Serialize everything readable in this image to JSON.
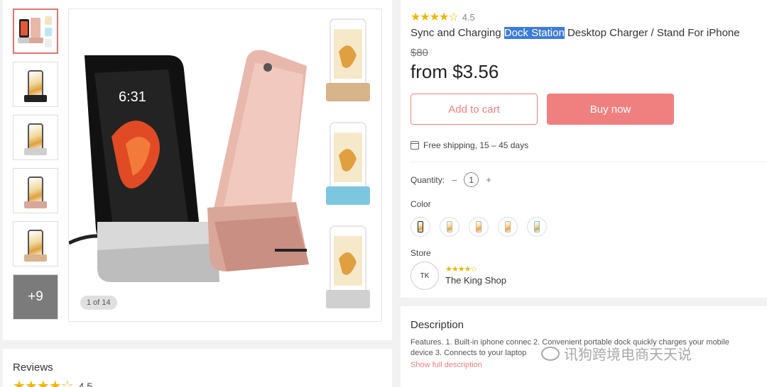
{
  "gallery": {
    "counter": "1 of 14",
    "more_label": "+9",
    "thumbnails": [
      {
        "alt": "dock-pair",
        "base": "#e8b7a8"
      },
      {
        "alt": "dock-black",
        "base": "#222222"
      },
      {
        "alt": "dock-silver",
        "base": "#cfcfcf"
      },
      {
        "alt": "dock-rose",
        "base": "#d9a79a"
      },
      {
        "alt": "dock-gold",
        "base": "#d8b48a"
      }
    ]
  },
  "product": {
    "rating_value": "4.5",
    "title_before": "Sync and Charging ",
    "title_highlight": "Dock Station",
    "title_after": " Desktop Charger / Stand For iPhone",
    "old_price": "$80",
    "price": "from $3.56",
    "add_to_cart": "Add to cart",
    "buy_now": "Buy now",
    "shipping": "Free shipping, 15 – 45 days",
    "quantity_label": "Quantity:",
    "quantity_minus": "–",
    "quantity_value": "1",
    "quantity_plus": "+",
    "color_label": "Color",
    "colors": [
      "#222222",
      "#cfcfcf",
      "#d9a79a",
      "#d8b48a",
      "#7cc6e0"
    ],
    "store_label": "Store",
    "store_initials": "TK",
    "store_name": "The King Shop"
  },
  "description": {
    "title": "Description",
    "text": "Features.  1. Built-in iphone connec      2. Convenient portable dock quickly charges your mobile\ndevice 3. Connects to your laptop",
    "link": "Show full description"
  },
  "reviews": {
    "title": "Reviews",
    "rating_value": "4.5"
  },
  "watermark": "讯狗跨境电商天天说",
  "colors": {
    "accent": "#f08080",
    "star": "#f2b400",
    "highlight": "#3d7bd9"
  }
}
